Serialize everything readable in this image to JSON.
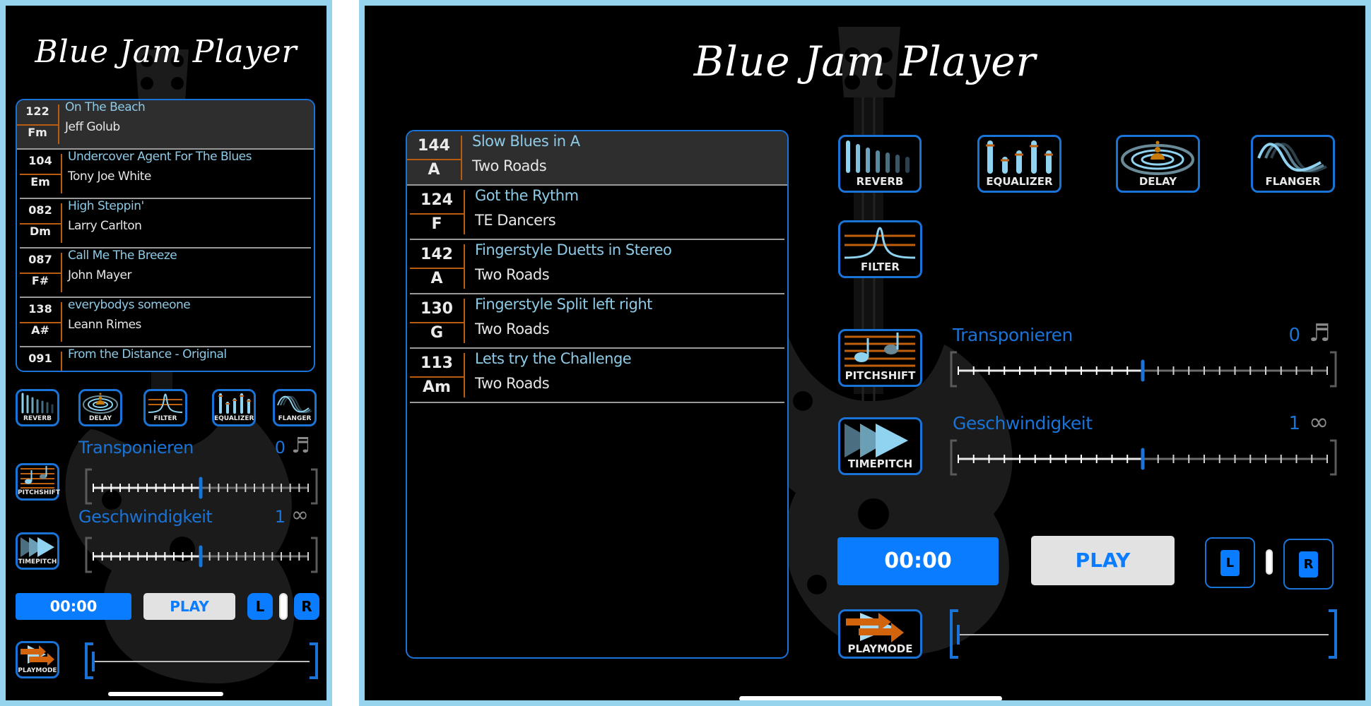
{
  "app": {
    "title": "Blue Jam Player",
    "accent_color": "#0a7cff",
    "frame_color": "#96d4ee"
  },
  "playlist": [
    {
      "bpm": "144",
      "key": "A",
      "song": "Slow Blues in A",
      "artist": "Two Roads",
      "device": "tablet",
      "selected": true
    },
    {
      "bpm": "124",
      "key": "F",
      "song": "Got the Rythm",
      "artist": "TE Dancers",
      "device": "tablet"
    },
    {
      "bpm": "142",
      "key": "A",
      "song": "Fingerstyle Duetts in Stereo",
      "artist": "Two Roads",
      "device": "tablet"
    },
    {
      "bpm": "130",
      "key": "G",
      "song": "Fingerstyle Split left right",
      "artist": "Two Roads",
      "device": "tablet"
    },
    {
      "bpm": "113",
      "key": "Am",
      "song": "Lets try the Challenge",
      "artist": "Two Roads",
      "device": "tablet"
    }
  ],
  "phone_playlist": [
    {
      "bpm": "122",
      "key": "Fm",
      "song": "On The Beach",
      "artist": "Jeff Golub",
      "selected": true
    },
    {
      "bpm": "104",
      "key": "Em",
      "song": "Undercover Agent For The Blues",
      "artist": "Tony Joe White"
    },
    {
      "bpm": "082",
      "key": "Dm",
      "song": "High Steppin'",
      "artist": "Larry Carlton"
    },
    {
      "bpm": "087",
      "key": "F#",
      "song": "Call Me The Breeze",
      "artist": "John Mayer"
    },
    {
      "bpm": "138",
      "key": "A#",
      "song": "everybodys someone",
      "artist": "Leann Rimes"
    },
    {
      "bpm": "091",
      "key": "",
      "song": "From the Distance - Original",
      "artist": ""
    }
  ],
  "effects": {
    "reverb": "REVERB",
    "equalizer": "EQUALIZER",
    "delay": "DELAY",
    "flanger": "FLANGER",
    "filter": "FILTER",
    "pitchshift": "PITCHSHIFT",
    "timepitch": "TIMEPITCH",
    "playmode": "PLAYMODE"
  },
  "controls": {
    "transpose": {
      "label": "Transponieren",
      "value": "0",
      "icon": "music-note-icon",
      "icon_glyph": "♬",
      "position": 0.5,
      "ticks": 25
    },
    "speed": {
      "label": "Geschwindigkeit",
      "value": "1",
      "icon": "infinity-icon",
      "icon_glyph": "∞",
      "position": 0.5,
      "ticks": 25
    }
  },
  "transport": {
    "time": "00:00",
    "play_label": "PLAY",
    "left_channel": "L",
    "right_channel": "R",
    "seek_position": 0.0
  }
}
